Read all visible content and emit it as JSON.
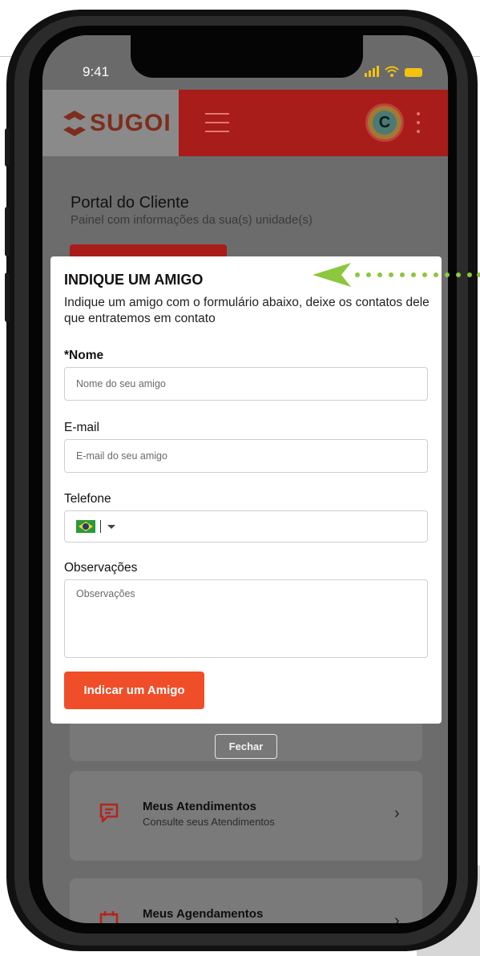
{
  "status_bar": {
    "time": "9:41"
  },
  "header": {
    "logo_text": "SUGOI",
    "avatar_letter": "C"
  },
  "page": {
    "title": "Portal do Cliente",
    "subtitle": "Painel com informações da sua(s) unidade(s)"
  },
  "modal": {
    "title": "INDIQUE UM AMIGO",
    "description": "Indique um amigo com o formulário abaixo, deixe os contatos dele que entratemos em contato",
    "name_label": "*Nome",
    "name_placeholder": "Nome do seu amigo",
    "email_label": "E-mail",
    "email_placeholder": "E-mail do seu amigo",
    "phone_label": "Telefone",
    "phone_country": "Brasil",
    "notes_label": "Observações",
    "notes_placeholder": "Observações",
    "submit_label": "Indicar um Amigo"
  },
  "close_label": "Fechar",
  "menu": [
    {
      "title": "Meus Atendimentos",
      "subtitle": "Consulte seus Atendimentos",
      "icon": "chat-icon"
    },
    {
      "title": "Meus Agendamentos",
      "subtitle": "",
      "icon": "calendar-icon"
    }
  ],
  "colors": {
    "brand_red": "#a81c19",
    "accent_orange": "#ef4e28",
    "arrow_green": "#8dc63f"
  }
}
